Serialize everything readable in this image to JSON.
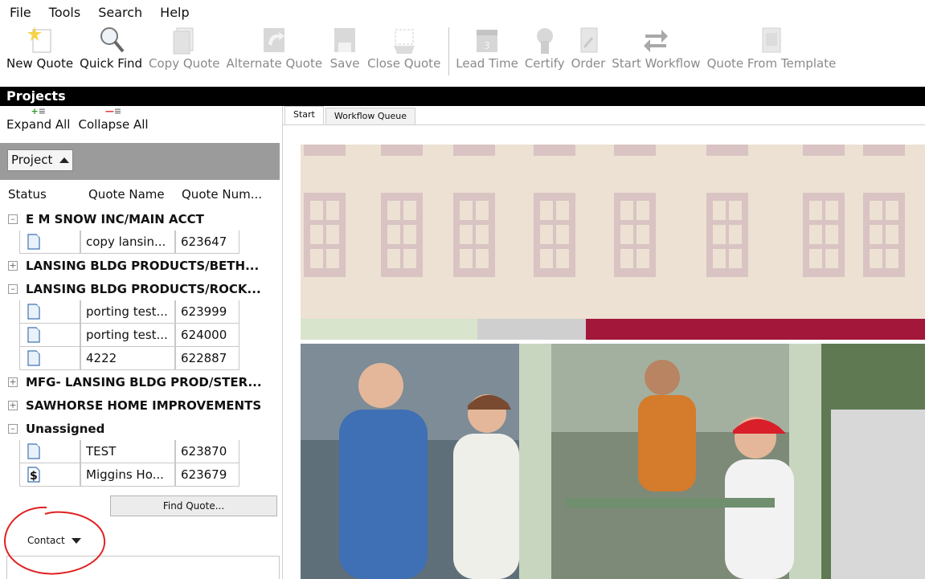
{
  "menu": [
    "File",
    "Tools",
    "Search",
    "Help"
  ],
  "toolbar": [
    {
      "label": "New Quote",
      "icon": "new-quote-icon",
      "enabled": true
    },
    {
      "label": "Quick Find",
      "icon": "magnifier-icon",
      "enabled": true
    },
    {
      "label": "Copy Quote",
      "icon": "copy-document-icon",
      "enabled": false
    },
    {
      "label": "Alternate Quote",
      "icon": "alternate-arrow-icon",
      "enabled": false
    },
    {
      "label": "Save",
      "icon": "floppy-disk-icon",
      "enabled": false
    },
    {
      "label": "Close Quote",
      "icon": "close-document-icon",
      "enabled": false
    },
    {
      "label": "Lead Time",
      "icon": "calendar-icon",
      "enabled": false
    },
    {
      "label": "Certify",
      "icon": "certificate-icon",
      "enabled": false
    },
    {
      "label": "Order",
      "icon": "order-document-icon",
      "enabled": false
    },
    {
      "label": "Start Workflow",
      "icon": "workflow-arrows-icon",
      "enabled": false
    },
    {
      "label": "Quote From Template",
      "icon": "template-icon",
      "enabled": false
    }
  ],
  "projects_title": "Projects",
  "expand_all": "Expand All",
  "collapse_all": "Collapse All",
  "group_by": "Project",
  "columns": [
    "Status",
    "Quote Name",
    "Quote Num..."
  ],
  "tree": [
    {
      "type": "group",
      "label": "E M SNOW INC/MAIN ACCT",
      "expanded": true
    },
    {
      "type": "item",
      "status": "document",
      "name": "copy lansin...",
      "num": "623647"
    },
    {
      "type": "group",
      "label": "LANSING BLDG PRODUCTS/BETH...",
      "expanded": false
    },
    {
      "type": "group",
      "label": "LANSING BLDG PRODUCTS/ROCK...",
      "expanded": true
    },
    {
      "type": "item",
      "status": "document",
      "name": "porting test...",
      "num": "623999"
    },
    {
      "type": "item",
      "status": "document",
      "name": "porting test...",
      "num": "624000"
    },
    {
      "type": "item",
      "status": "document",
      "name": "4222",
      "num": "622887"
    },
    {
      "type": "group",
      "label": "MFG- LANSING BLDG PROD/STER...",
      "expanded": false
    },
    {
      "type": "group",
      "label": "SAWHORSE HOME IMPROVEMENTS",
      "expanded": false
    },
    {
      "type": "group",
      "label": "Unassigned",
      "expanded": true
    },
    {
      "type": "item",
      "status": "document",
      "name": "TEST",
      "num": "623870"
    },
    {
      "type": "item",
      "status": "dollar",
      "name": "Miggins Ho...",
      "num": "623679"
    }
  ],
  "find_quote": "Find Quote...",
  "contact_dropdown": "Contact",
  "tabs": [
    {
      "label": "Start",
      "active": true
    },
    {
      "label": "Workflow Queue",
      "active": false
    }
  ],
  "banner_colors": {
    "wall": "#ece1d3",
    "window": "#d9c3c3",
    "stripe_grey": "#cfcfcf",
    "stripe_crimson": "#a3173a",
    "stripe_green": "#d8e4cc"
  }
}
